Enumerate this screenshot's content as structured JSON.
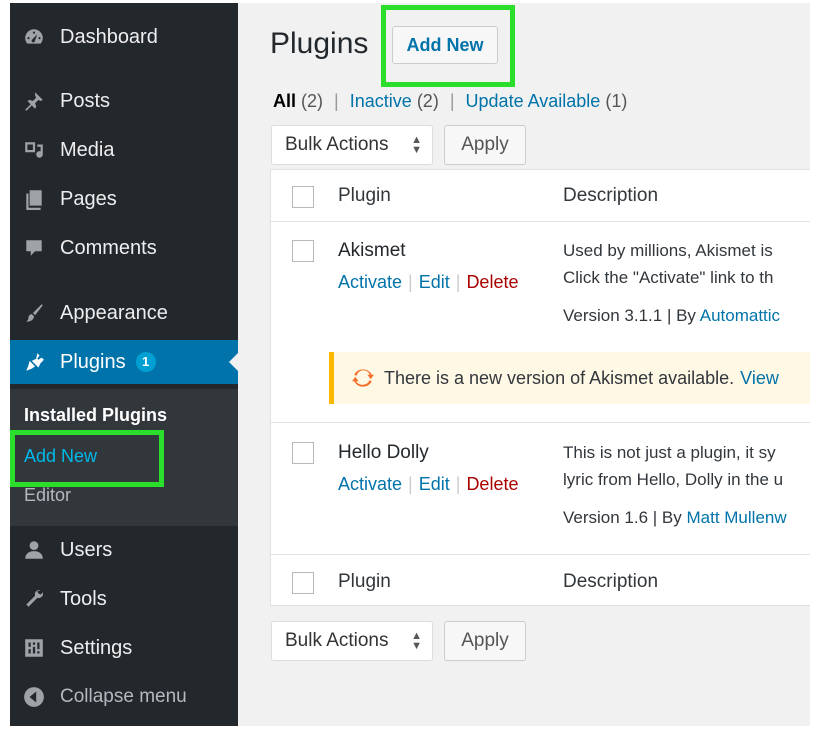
{
  "sidebar": {
    "items": [
      {
        "label": "Dashboard",
        "icon": "dashboard-icon"
      },
      {
        "label": "Posts",
        "icon": "pin-icon"
      },
      {
        "label": "Media",
        "icon": "media-icon"
      },
      {
        "label": "Pages",
        "icon": "pages-icon"
      },
      {
        "label": "Comments",
        "icon": "comment-icon"
      },
      {
        "label": "Appearance",
        "icon": "brush-icon"
      },
      {
        "label": "Plugins",
        "icon": "plugin-icon",
        "badge": "1"
      },
      {
        "label": "Users",
        "icon": "users-icon"
      },
      {
        "label": "Tools",
        "icon": "wrench-icon"
      },
      {
        "label": "Settings",
        "icon": "settings-icon"
      },
      {
        "label": "Collapse menu",
        "icon": "collapse-icon"
      }
    ],
    "submenu": {
      "heading": "Installed Plugins",
      "add_new": "Add New",
      "editor": "Editor"
    }
  },
  "header": {
    "title": "Plugins",
    "add_new": "Add New"
  },
  "filters": {
    "all": "All",
    "all_count": "(2)",
    "inactive": "Inactive",
    "inactive_count": "(2)",
    "update": "Update Available",
    "update_count": "(1)",
    "separator": "|"
  },
  "bulk": {
    "label": "Bulk Actions",
    "apply": "Apply"
  },
  "table": {
    "columns": [
      "Plugin",
      "Description"
    ],
    "rows": [
      {
        "name": "Akismet",
        "actions": [
          "Activate",
          "Edit",
          "Delete"
        ],
        "desc_line1": "Used by millions, Akismet is",
        "desc_line2": "Click the \"Activate\" link to th",
        "version": "Version 3.1.1 | By ",
        "author": "Automattic"
      },
      {
        "name": "Hello Dolly",
        "actions": [
          "Activate",
          "Edit",
          "Delete"
        ],
        "desc_line1": "This is not just a plugin, it sy",
        "desc_line2": "lyric from Hello, Dolly in the u",
        "version": "Version 1.6 | By ",
        "author": "Matt Mullenw"
      }
    ],
    "notice": {
      "text": "There is a new version of Akismet available.",
      "link": "View"
    }
  },
  "colors": {
    "sidebar_bg": "#23282d",
    "accent": "#0073aa",
    "highlight": "#2bde2b",
    "delete": "#aa0000",
    "notice_border": "#ffb900"
  }
}
